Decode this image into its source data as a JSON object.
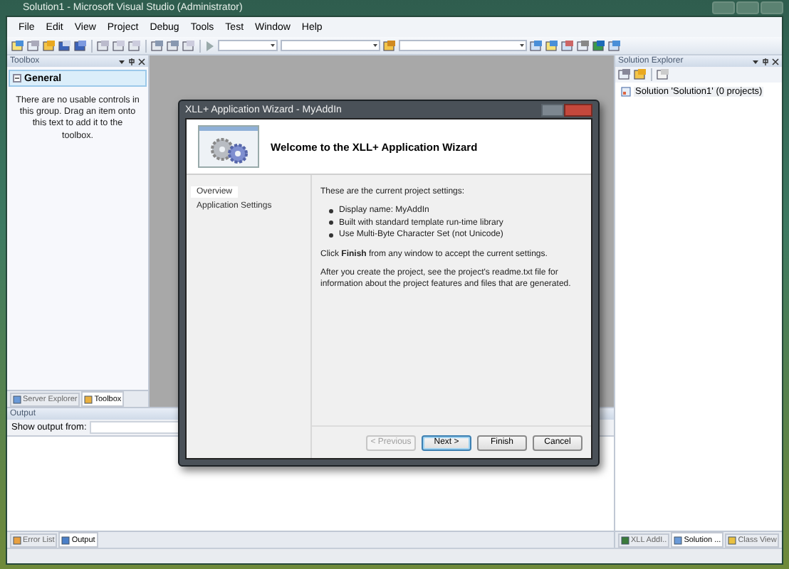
{
  "window": {
    "title": "Solution1 - Microsoft Visual Studio (Administrator)"
  },
  "menu": [
    "File",
    "Edit",
    "View",
    "Project",
    "Debug",
    "Tools",
    "Test",
    "Window",
    "Help"
  ],
  "toolbox": {
    "title": "Toolbox",
    "group": {
      "label": "General",
      "expanded": true
    },
    "empty_text": "There are no usable controls in this group. Drag an item onto this text to add it to the toolbox.",
    "tabs": [
      {
        "label": "Server Explorer",
        "selected": false
      },
      {
        "label": "Toolbox",
        "selected": true
      }
    ]
  },
  "output": {
    "title": "Output",
    "show_output_from": "Show output from:",
    "tabs": [
      {
        "label": "Error List",
        "selected": false
      },
      {
        "label": "Output",
        "selected": true
      }
    ]
  },
  "solution_explorer": {
    "title": "Solution Explorer",
    "tree": [
      {
        "label": "Solution 'Solution1' (0 projects)"
      }
    ],
    "tabs": [
      {
        "label": "XLL AddI..",
        "selected": false
      },
      {
        "label": "Solution ...",
        "selected": true
      },
      {
        "label": "Class View",
        "selected": false
      }
    ]
  },
  "dialog": {
    "title": "XLL+ Application Wizard - MyAddIn",
    "heading": "Welcome to the XLL+ Application Wizard",
    "nav": [
      {
        "label": "Overview",
        "selected": true
      },
      {
        "label": "Application Settings",
        "selected": false
      }
    ],
    "intro": "These are the current project settings:",
    "bullets": [
      "Display name: MyAddIn",
      "Built with standard template run-time library",
      "Use Multi-Byte Character Set (not Unicode)"
    ],
    "paragraphs": [
      "Click **Finish** from any window to accept the current settings.",
      "After you create the project, see the project's readme.txt file for information about the project features and files that are generated."
    ],
    "buttons": [
      {
        "label": "< Previous",
        "disabled": true,
        "default": false
      },
      {
        "label": "Next >",
        "disabled": false,
        "default": true
      },
      {
        "label": "Finish",
        "disabled": false,
        "default": false
      },
      {
        "label": "Cancel",
        "disabled": false,
        "default": false
      }
    ]
  }
}
